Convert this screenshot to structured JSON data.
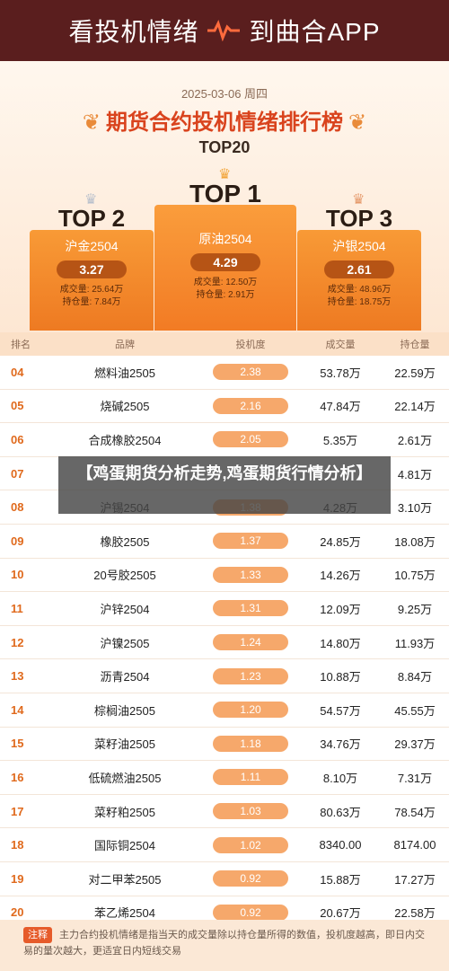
{
  "banner": {
    "left": "看投机情绪",
    "right": "到曲合APP"
  },
  "header": {
    "date": "2025-03-06 周四",
    "title": "期货合约投机情绪排行榜",
    "subtitle": "TOP20"
  },
  "podium": [
    {
      "rank_label": "TOP 1",
      "name": "原油2504",
      "score": "4.29",
      "volume": "成交量: 12.50万",
      "oi": "持仓量: 2.91万"
    },
    {
      "rank_label": "TOP 2",
      "name": "沪金2504",
      "score": "3.27",
      "volume": "成交量: 25.64万",
      "oi": "持仓量: 7.84万"
    },
    {
      "rank_label": "TOP 3",
      "name": "沪银2504",
      "score": "2.61",
      "volume": "成交量: 48.96万",
      "oi": "持仓量: 18.75万"
    }
  ],
  "table": {
    "headers": [
      "排名",
      "品牌",
      "投机度",
      "成交量",
      "持仓量"
    ],
    "rows": [
      {
        "rank": "04",
        "name": "燃料油2505",
        "score": "2.38",
        "volume": "53.78万",
        "oi": "22.59万"
      },
      {
        "rank": "05",
        "name": "烧碱2505",
        "score": "2.16",
        "volume": "47.84万",
        "oi": "22.14万"
      },
      {
        "rank": "06",
        "name": "合成橡胶2504",
        "score": "2.05",
        "volume": "5.35万",
        "oi": "2.61万"
      },
      {
        "rank": "07",
        "name": "",
        "score": "",
        "volume": "",
        "oi": "4.81万"
      },
      {
        "rank": "08",
        "name": "沪锡2504",
        "score": "1.38",
        "volume": "4.28万",
        "oi": "3.10万"
      },
      {
        "rank": "09",
        "name": "橡胶2505",
        "score": "1.37",
        "volume": "24.85万",
        "oi": "18.08万"
      },
      {
        "rank": "10",
        "name": "20号胶2505",
        "score": "1.33",
        "volume": "14.26万",
        "oi": "10.75万"
      },
      {
        "rank": "11",
        "name": "沪锌2504",
        "score": "1.31",
        "volume": "12.09万",
        "oi": "9.25万"
      },
      {
        "rank": "12",
        "name": "沪镍2505",
        "score": "1.24",
        "volume": "14.80万",
        "oi": "11.93万"
      },
      {
        "rank": "13",
        "name": "沥青2504",
        "score": "1.23",
        "volume": "10.88万",
        "oi": "8.84万"
      },
      {
        "rank": "14",
        "name": "棕榈油2505",
        "score": "1.20",
        "volume": "54.57万",
        "oi": "45.55万"
      },
      {
        "rank": "15",
        "name": "菜籽油2505",
        "score": "1.18",
        "volume": "34.76万",
        "oi": "29.37万"
      },
      {
        "rank": "16",
        "name": "低硫燃油2505",
        "score": "1.11",
        "volume": "8.10万",
        "oi": "7.31万"
      },
      {
        "rank": "17",
        "name": "菜籽粕2505",
        "score": "1.03",
        "volume": "80.63万",
        "oi": "78.54万"
      },
      {
        "rank": "18",
        "name": "国际铜2504",
        "score": "1.02",
        "volume": "8340.00",
        "oi": "8174.00"
      },
      {
        "rank": "19",
        "name": "对二甲苯2505",
        "score": "0.92",
        "volume": "15.88万",
        "oi": "17.27万"
      },
      {
        "rank": "20",
        "name": "苯乙烯2504",
        "score": "0.92",
        "volume": "20.67万",
        "oi": "22.58万"
      }
    ]
  },
  "overlay": "【鸡蛋期货分析走势,鸡蛋期货行情分析】",
  "note": {
    "tag": "注释",
    "text": "主力合约投机情绪是指当天的成交量除以持仓量所得的数值，投机度越高，即日内交易的量次越大，更适宜日内短线交易"
  },
  "colors": {
    "accent": "#f27b24",
    "banner": "#5a1e1e",
    "rank": "#e06a1d"
  }
}
